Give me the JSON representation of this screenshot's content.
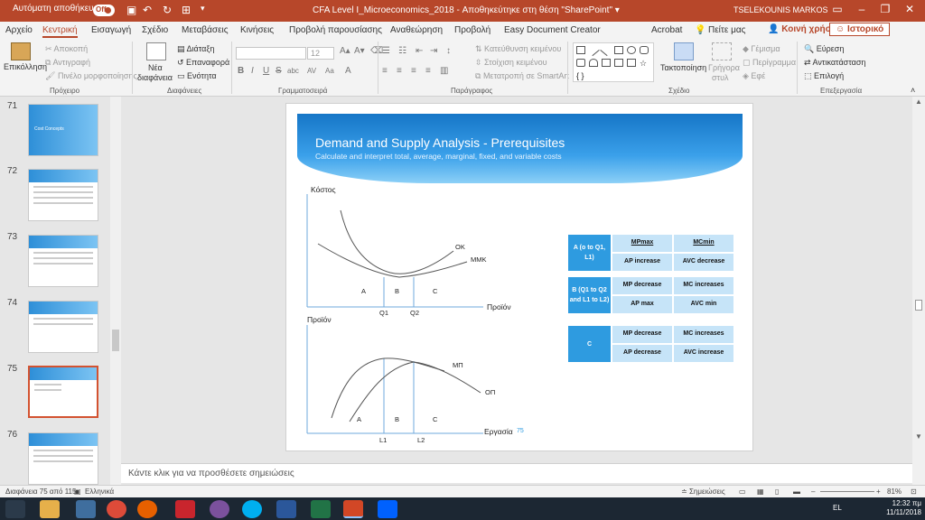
{
  "titlebar": {
    "autosave_label": "Αυτόματη αποθήκευση",
    "autosave_state": "Off",
    "document_title": "CFA Level I_Microeconomics_2018  -  Αποθηκεύτηκε στη θέση \"SharePoint\"  ▾",
    "user": "TSELEKOUNIS MARKOS"
  },
  "menu": {
    "tabs": [
      "Αρχείο",
      "Κεντρική",
      "Εισαγωγή",
      "Σχέδιο",
      "Μεταβάσεις",
      "Κινήσεις",
      "Προβολή παρουσίασης",
      "Αναθεώρηση",
      "Προβολή",
      "Easy Document Creator",
      "Acrobat"
    ],
    "active_tab": "Κεντρική",
    "tell_me": "Πείτε μας",
    "share": "Κοινή χρήση",
    "history": "Ιστορικό"
  },
  "ribbon": {
    "clipboard": {
      "paste": "Επικόλληση",
      "cut": "Αποκοπή",
      "copy": "Αντιγραφή",
      "format_painter": "Πινέλο μορφοποίησης",
      "group": "Πρόχειρο"
    },
    "slides": {
      "new_slide": "Νέα",
      "new_slide_2": "διαφάνεια",
      "layout": "Διάταξη",
      "reset": "Επαναφορά",
      "section": "Ενότητα",
      "group": "Διαφάνειες"
    },
    "font": {
      "font_size": "12",
      "group": "Γραμματοσειρά",
      "bold": "B",
      "italic": "I",
      "underline": "U",
      "strike": "S",
      "shadow": "abc",
      "spacing": "AV",
      "case": "Aa"
    },
    "paragraph": {
      "text_direction": "Κατεύθυνση κειμένου",
      "align_text": "Στοίχιση κειμένου",
      "smartart": "Μετατροπή σε SmartArt",
      "group": "Παράγραφος"
    },
    "drawing": {
      "arrange": "Τακτοποίηση",
      "quick_styles": "Γρήγορα",
      "quick_styles_2": "στυλ",
      "fill": "Γέμισμα",
      "outline": "Περίγραμμα",
      "effects": "Εφέ",
      "group": "Σχέδιο"
    },
    "editing": {
      "find": "Εύρεση",
      "replace": "Αντικατάσταση",
      "select": "Επιλογή",
      "group": "Επεξεργασία"
    }
  },
  "thumbnails": [
    {
      "num": "71",
      "caption": "Cost Concepts"
    },
    {
      "num": "72"
    },
    {
      "num": "73"
    },
    {
      "num": "74"
    },
    {
      "num": "75"
    },
    {
      "num": "76"
    }
  ],
  "slide": {
    "title": "Demand and Supply Analysis - Prerequisites",
    "subtitle": "Calculate and interpret total, average, marginal, fixed, and variable costs",
    "top_chart": {
      "ylabel": "Κόστος",
      "xlabel": "Προϊόν",
      "curve1": "ΟΚ",
      "curve2": "ΜΜΚ",
      "region_a": "A",
      "region_b": "B",
      "region_c": "C",
      "tick1": "Q1",
      "tick2": "Q2"
    },
    "bottom_chart": {
      "ylabel": "Προϊόν",
      "xlabel": "Εργασία",
      "curve1": "ΜΠ",
      "curve2": "ΟΠ",
      "region_a": "A",
      "region_b": "B",
      "region_c": "C",
      "tick1": "L1",
      "tick2": "L2"
    },
    "page_number": "75",
    "table": [
      {
        "head": "A (o to Q1, L1)",
        "r1": [
          "MPmax",
          "MCmin"
        ],
        "r2": [
          "AP increase",
          "AVC decrease"
        ]
      },
      {
        "head": "B (Q1 to Q2 and L1 to L2)",
        "r1": [
          "MP decrease",
          "MC increases"
        ],
        "r2": [
          "AP max",
          "AVC min"
        ]
      },
      {
        "head": "C",
        "r1": [
          "MP decrease",
          "MC increases"
        ],
        "r2": [
          "AP decrease",
          "AVC increase"
        ]
      }
    ]
  },
  "notes_placeholder": "Κάντε κλικ για να προσθέσετε σημειώσεις",
  "status": {
    "slide_count": "Διαφάνεια 75 από 115",
    "language": "Ελληνικά",
    "notes": "Σημειώσεις",
    "zoom": "81%"
  },
  "taskbar": {
    "lang": "EL",
    "time": "12:32 πμ",
    "date": "11/11/2018"
  },
  "colors": {
    "accent": "#b7472a",
    "slide_blue": "#2e9be0",
    "cell_light": "#c6e4f8"
  }
}
